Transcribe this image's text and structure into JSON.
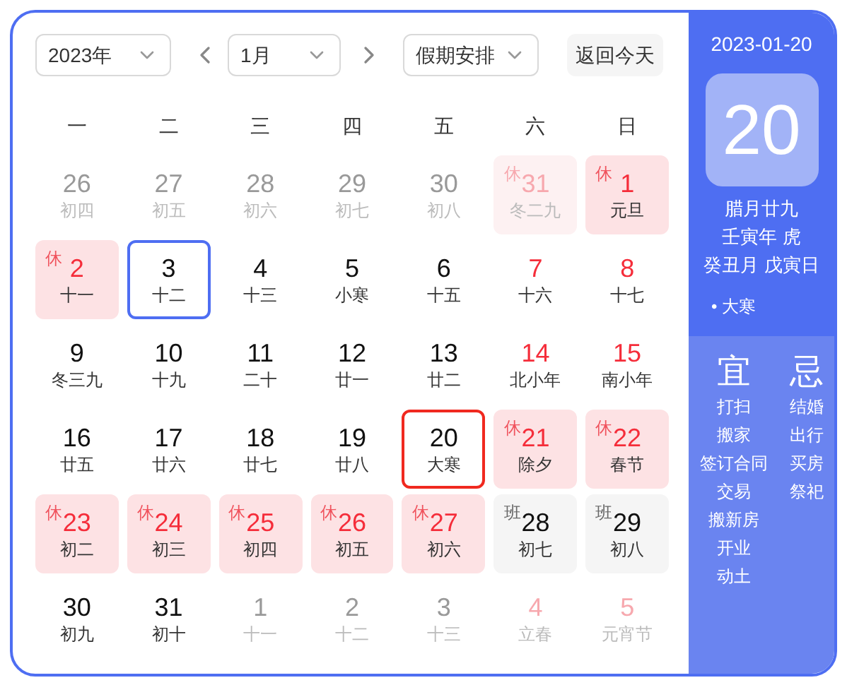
{
  "controls": {
    "year": "2023年",
    "month": "1月",
    "holiday": "假期安排",
    "today_button": "返回今天"
  },
  "weekdays": [
    "一",
    "二",
    "三",
    "四",
    "五",
    "六",
    "日"
  ],
  "days": [
    {
      "day": "26",
      "lunar": "初四",
      "in_month": false,
      "red": false,
      "selected": false,
      "today": false
    },
    {
      "day": "27",
      "lunar": "初五",
      "in_month": false,
      "red": false,
      "selected": false,
      "today": false
    },
    {
      "day": "28",
      "lunar": "初六",
      "in_month": false,
      "red": false,
      "selected": false,
      "today": false
    },
    {
      "day": "29",
      "lunar": "初七",
      "in_month": false,
      "red": false,
      "selected": false,
      "today": false
    },
    {
      "day": "30",
      "lunar": "初八",
      "in_month": false,
      "red": false,
      "selected": false,
      "today": false
    },
    {
      "day": "31",
      "lunar": "冬二九",
      "in_month": false,
      "red": true,
      "badge": {
        "text": "休",
        "kind": "rest"
      },
      "selected": false,
      "today": false
    },
    {
      "day": "1",
      "lunar": "元旦",
      "in_month": true,
      "red": true,
      "badge": {
        "text": "休",
        "kind": "rest"
      },
      "selected": false,
      "today": false
    },
    {
      "day": "2",
      "lunar": "十一",
      "in_month": true,
      "red": true,
      "badge": {
        "text": "休",
        "kind": "rest"
      },
      "selected": false,
      "today": false
    },
    {
      "day": "3",
      "lunar": "十二",
      "in_month": true,
      "red": false,
      "selected": true,
      "today": false
    },
    {
      "day": "4",
      "lunar": "十三",
      "in_month": true,
      "red": false,
      "selected": false,
      "today": false
    },
    {
      "day": "5",
      "lunar": "小寒",
      "in_month": true,
      "red": false,
      "selected": false,
      "today": false
    },
    {
      "day": "6",
      "lunar": "十五",
      "in_month": true,
      "red": false,
      "selected": false,
      "today": false
    },
    {
      "day": "7",
      "lunar": "十六",
      "in_month": true,
      "red": true,
      "selected": false,
      "today": false
    },
    {
      "day": "8",
      "lunar": "十七",
      "in_month": true,
      "red": true,
      "selected": false,
      "today": false
    },
    {
      "day": "9",
      "lunar": "冬三九",
      "in_month": true,
      "red": false,
      "selected": false,
      "today": false
    },
    {
      "day": "10",
      "lunar": "十九",
      "in_month": true,
      "red": false,
      "selected": false,
      "today": false
    },
    {
      "day": "11",
      "lunar": "二十",
      "in_month": true,
      "red": false,
      "selected": false,
      "today": false
    },
    {
      "day": "12",
      "lunar": "廿一",
      "in_month": true,
      "red": false,
      "selected": false,
      "today": false
    },
    {
      "day": "13",
      "lunar": "廿二",
      "in_month": true,
      "red": false,
      "selected": false,
      "today": false
    },
    {
      "day": "14",
      "lunar": "北小年",
      "in_month": true,
      "red": true,
      "selected": false,
      "today": false
    },
    {
      "day": "15",
      "lunar": "南小年",
      "in_month": true,
      "red": true,
      "selected": false,
      "today": false
    },
    {
      "day": "16",
      "lunar": "廿五",
      "in_month": true,
      "red": false,
      "selected": false,
      "today": false
    },
    {
      "day": "17",
      "lunar": "廿六",
      "in_month": true,
      "red": false,
      "selected": false,
      "today": false
    },
    {
      "day": "18",
      "lunar": "廿七",
      "in_month": true,
      "red": false,
      "selected": false,
      "today": false
    },
    {
      "day": "19",
      "lunar": "廿八",
      "in_month": true,
      "red": false,
      "selected": false,
      "today": false
    },
    {
      "day": "20",
      "lunar": "大寒",
      "in_month": true,
      "red": false,
      "selected": false,
      "today": true
    },
    {
      "day": "21",
      "lunar": "除夕",
      "in_month": true,
      "red": true,
      "badge": {
        "text": "休",
        "kind": "rest"
      },
      "selected": false,
      "today": false
    },
    {
      "day": "22",
      "lunar": "春节",
      "in_month": true,
      "red": true,
      "badge": {
        "text": "休",
        "kind": "rest"
      },
      "selected": false,
      "today": false
    },
    {
      "day": "23",
      "lunar": "初二",
      "in_month": true,
      "red": true,
      "badge": {
        "text": "休",
        "kind": "rest"
      },
      "selected": false,
      "today": false
    },
    {
      "day": "24",
      "lunar": "初三",
      "in_month": true,
      "red": true,
      "badge": {
        "text": "休",
        "kind": "rest"
      },
      "selected": false,
      "today": false
    },
    {
      "day": "25",
      "lunar": "初四",
      "in_month": true,
      "red": true,
      "badge": {
        "text": "休",
        "kind": "rest"
      },
      "selected": false,
      "today": false
    },
    {
      "day": "26",
      "lunar": "初五",
      "in_month": true,
      "red": true,
      "badge": {
        "text": "休",
        "kind": "rest"
      },
      "selected": false,
      "today": false
    },
    {
      "day": "27",
      "lunar": "初六",
      "in_month": true,
      "red": true,
      "badge": {
        "text": "休",
        "kind": "rest"
      },
      "selected": false,
      "today": false
    },
    {
      "day": "28",
      "lunar": "初七",
      "in_month": true,
      "red": false,
      "badge": {
        "text": "班",
        "kind": "work"
      },
      "selected": false,
      "today": false
    },
    {
      "day": "29",
      "lunar": "初八",
      "in_month": true,
      "red": false,
      "badge": {
        "text": "班",
        "kind": "work"
      },
      "selected": false,
      "today": false
    },
    {
      "day": "30",
      "lunar": "初九",
      "in_month": true,
      "red": false,
      "selected": false,
      "today": false
    },
    {
      "day": "31",
      "lunar": "初十",
      "in_month": true,
      "red": false,
      "selected": false,
      "today": false
    },
    {
      "day": "1",
      "lunar": "十一",
      "in_month": false,
      "red": false,
      "selected": false,
      "today": false
    },
    {
      "day": "2",
      "lunar": "十二",
      "in_month": false,
      "red": false,
      "selected": false,
      "today": false
    },
    {
      "day": "3",
      "lunar": "十三",
      "in_month": false,
      "red": false,
      "selected": false,
      "today": false
    },
    {
      "day": "4",
      "lunar": "立春",
      "in_month": false,
      "red": true,
      "selected": false,
      "today": false
    },
    {
      "day": "5",
      "lunar": "元宵节",
      "in_month": false,
      "red": true,
      "selected": false,
      "today": false
    }
  ],
  "detail": {
    "date": "2023-01-20",
    "day": "20",
    "lunar_lines": [
      "腊月廿九",
      "壬寅年 虎",
      "癸丑月 戊寅日"
    ],
    "term": "• 大寒",
    "good": {
      "title": "宜",
      "items": [
        "打扫",
        "搬家",
        "签订合同",
        "交易",
        "搬新房",
        "开业",
        "动土"
      ]
    },
    "bad": {
      "title": "忌",
      "items": [
        "结婚",
        "出行",
        "买房",
        "祭祀"
      ]
    }
  }
}
